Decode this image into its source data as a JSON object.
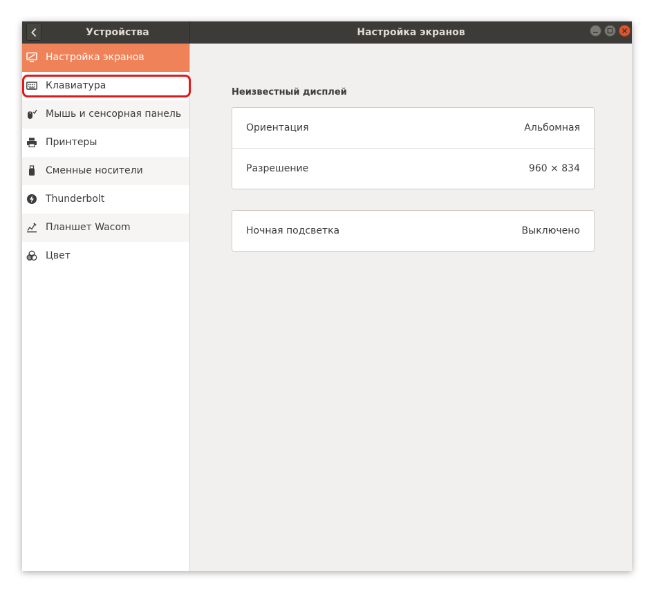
{
  "titlebar": {
    "sidebar_title": "Устройства",
    "main_title": "Настройка экранов"
  },
  "sidebar": {
    "items": [
      {
        "label": "Настройка экранов",
        "icon": "display-icon"
      },
      {
        "label": "Клавиатура",
        "icon": "keyboard-icon"
      },
      {
        "label": "Мышь и сенсорная панель",
        "icon": "mouse-icon"
      },
      {
        "label": "Принтеры",
        "icon": "printer-icon"
      },
      {
        "label": "Сменные носители",
        "icon": "usb-drive-icon"
      },
      {
        "label": "Thunderbolt",
        "icon": "thunderbolt-icon"
      },
      {
        "label": "Планшет Wacom",
        "icon": "wacom-tablet-icon"
      },
      {
        "label": "Цвет",
        "icon": "color-icon"
      }
    ]
  },
  "display": {
    "section_title": "Неизвестный дисплей",
    "orientation_label": "Ориентация",
    "orientation_value": "Альбомная",
    "resolution_label": "Разрешение",
    "resolution_value": "960 × 834",
    "night_light_label": "Ночная подсветка",
    "night_light_value": "Выключено"
  },
  "colors": {
    "accent": "#f0825a",
    "titlebar": "#3c3b37",
    "highlight": "#e0191b",
    "close_button": "#e2542b"
  }
}
